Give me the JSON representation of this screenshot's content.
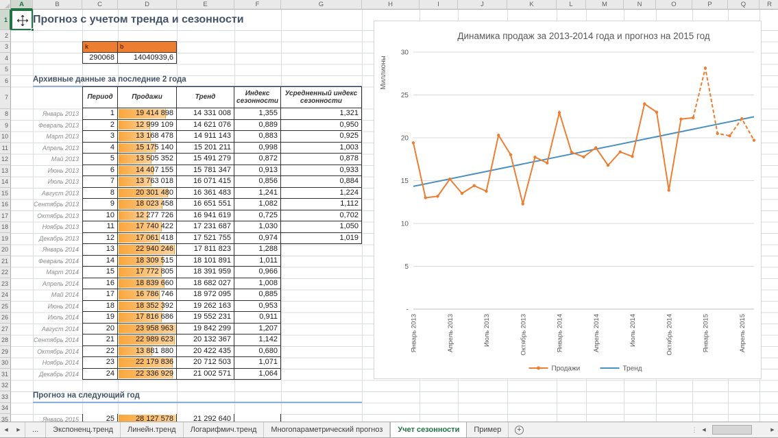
{
  "app": {
    "selected_cell": "A1"
  },
  "colors": {
    "excel_green": "#217346",
    "accent_orange": "#ED7D31",
    "databar_orange": "#F9A63C",
    "trend_blue": "#4A90C2",
    "heading_text": "#44546A",
    "heading_underline": "#8FAADC"
  },
  "grid": {
    "columns": [
      "A",
      "B",
      "C",
      "D",
      "E",
      "F",
      "G",
      "H",
      "I",
      "J",
      "K",
      "L",
      "M",
      "N",
      "O",
      "P",
      "Q",
      "R"
    ],
    "rows": [
      1,
      2,
      3,
      4,
      5,
      6,
      7,
      8,
      9,
      10,
      11,
      12,
      13,
      14,
      15,
      16,
      17,
      18,
      19,
      20,
      21,
      22,
      23,
      24,
      25,
      26,
      27,
      28,
      29,
      30,
      31,
      32,
      33,
      34,
      35
    ]
  },
  "sheet": {
    "title": "Прогноз с учетом тренда и сезонности",
    "kb": {
      "k_label": "k",
      "b_label": "b",
      "k_value": "290068",
      "b_value": "14040939,6"
    },
    "section_archive": "Архивные данные за последние 2 года",
    "section_forecast": "Прогноз на следующий год",
    "table": {
      "headers": [
        "Период",
        "Продажи",
        "Тренд",
        "Индекс сезонности",
        "Усредненный индекс сезонности"
      ],
      "rows": [
        {
          "month": "Январь 2013",
          "period": "1",
          "sales": "19 414 898",
          "trend": "14 331 008",
          "index": "1,355",
          "avg": "1,321"
        },
        {
          "month": "Февраль 2013",
          "period": "2",
          "sales": "12 999 109",
          "trend": "14 621 076",
          "index": "0,889",
          "avg": "0,950"
        },
        {
          "month": "Март 2013",
          "period": "3",
          "sales": "13 168 478",
          "trend": "14 911 143",
          "index": "0,883",
          "avg": "0,925"
        },
        {
          "month": "Апрель 2013",
          "period": "4",
          "sales": "15 175 140",
          "trend": "15 201 211",
          "index": "0,998",
          "avg": "1,003"
        },
        {
          "month": "Май 2013",
          "period": "5",
          "sales": "13 505 352",
          "trend": "15 491 279",
          "index": "0,872",
          "avg": "0,878"
        },
        {
          "month": "Июнь 2013",
          "period": "6",
          "sales": "14 407 155",
          "trend": "15 781 347",
          "index": "0,913",
          "avg": "0,933"
        },
        {
          "month": "Июль 2013",
          "period": "7",
          "sales": "13 763 018",
          "trend": "16 071 415",
          "index": "0,856",
          "avg": "0,884"
        },
        {
          "month": "Август 2013",
          "period": "8",
          "sales": "20 301 480",
          "trend": "16 361 483",
          "index": "1,241",
          "avg": "1,224"
        },
        {
          "month": "Сентябрь 2013",
          "period": "9",
          "sales": "18 023 458",
          "trend": "16 651 551",
          "index": "1,082",
          "avg": "1,112"
        },
        {
          "month": "Октябрь 2013",
          "period": "10",
          "sales": "12 277 726",
          "trend": "16 941 619",
          "index": "0,725",
          "avg": "0,702"
        },
        {
          "month": "Ноябрь 2013",
          "period": "11",
          "sales": "17 740 422",
          "trend": "17 231 687",
          "index": "1,030",
          "avg": "1,050"
        },
        {
          "month": "Декабрь 2013",
          "period": "12",
          "sales": "17 061 418",
          "trend": "17 521 755",
          "index": "0,974",
          "avg": "1,019"
        },
        {
          "month": "Январь 2014",
          "period": "13",
          "sales": "22 940 246",
          "trend": "17 811 823",
          "index": "1,288",
          "avg": ""
        },
        {
          "month": "Февраль 2014",
          "period": "14",
          "sales": "18 309 515",
          "trend": "18 101 891",
          "index": "1,011",
          "avg": ""
        },
        {
          "month": "Март 2014",
          "period": "15",
          "sales": "17 772 805",
          "trend": "18 391 959",
          "index": "0,966",
          "avg": ""
        },
        {
          "month": "Апрель 2014",
          "period": "16",
          "sales": "18 839 660",
          "trend": "18 682 027",
          "index": "1,008",
          "avg": ""
        },
        {
          "month": "Май 2014",
          "period": "17",
          "sales": "16 786 746",
          "trend": "18 972 095",
          "index": "0,885",
          "avg": ""
        },
        {
          "month": "Июнь 2014",
          "period": "18",
          "sales": "18 352 392",
          "trend": "19 262 163",
          "index": "0,953",
          "avg": ""
        },
        {
          "month": "Июль 2014",
          "period": "19",
          "sales": "17 816 686",
          "trend": "19 552 231",
          "index": "0,911",
          "avg": ""
        },
        {
          "month": "Август 2014",
          "period": "20",
          "sales": "23 958 963",
          "trend": "19 842 299",
          "index": "1,207",
          "avg": ""
        },
        {
          "month": "Сентябрь 2014",
          "period": "21",
          "sales": "22 989 623",
          "trend": "20 132 367",
          "index": "1,142",
          "avg": ""
        },
        {
          "month": "Октябрь 2014",
          "period": "22",
          "sales": "13 881 880",
          "trend": "20 422 435",
          "index": "0,680",
          "avg": ""
        },
        {
          "month": "Ноябрь 2014",
          "period": "23",
          "sales": "22 179 836",
          "trend": "20 712 503",
          "index": "1,071",
          "avg": ""
        },
        {
          "month": "Декабрь 2014",
          "period": "24",
          "sales": "22 336 929",
          "trend": "21 002 571",
          "index": "1,064",
          "avg": ""
        }
      ],
      "forecast_row": {
        "month": "Январь 2015",
        "period": "25",
        "sales": "28 127 578",
        "trend": "21 292 640",
        "index": "",
        "avg": ""
      }
    }
  },
  "chart_data": {
    "type": "line",
    "title": "Динамика продаж за 2013-2014 года и прогноз на 2015 год",
    "y_axis_label": "Миллионы",
    "ylim": [
      0,
      30
    ],
    "y_tick_values": [
      30,
      25,
      20,
      15,
      10,
      5,
      0
    ],
    "y_tick_labels": [
      "30",
      "25",
      "20",
      "15",
      "10",
      "5",
      "-"
    ],
    "x_range": [
      1,
      29
    ],
    "x_tick_periods": [
      1,
      4,
      7,
      10,
      13,
      16,
      19,
      22,
      25,
      28
    ],
    "x_tick_labels": [
      "Январь 2013",
      "Апрель 2013",
      "Июль 2013",
      "Октябрь 2013",
      "Январь 2014",
      "Апрель 2014",
      "Июль 2014",
      "Октябрь 2014",
      "Январь 2015",
      "Апрель 2015"
    ],
    "grid": true,
    "legend_position": "bottom",
    "legend": [
      "Продажи",
      "Тренд"
    ],
    "series": [
      {
        "name": "Продажи",
        "color": "#ED7D31",
        "style": "solid-then-dashed",
        "actual_millions": [
          19.41,
          13.0,
          13.17,
          15.18,
          13.51,
          14.41,
          13.76,
          20.3,
          18.02,
          12.28,
          17.74,
          17.06,
          22.94,
          18.31,
          17.77,
          18.84,
          16.79,
          18.35,
          17.82,
          23.96,
          22.99,
          13.88,
          22.18,
          22.34
        ],
        "forecast_millions": [
          28.13,
          20.5,
          20.23,
          22.23,
          19.71
        ]
      },
      {
        "name": "Тренд",
        "color": "#4A90C2",
        "style": "solid",
        "line": [
          [
            1,
            14.33
          ],
          [
            29,
            22.45
          ]
        ]
      }
    ]
  },
  "tabs": {
    "overflow_label": "...",
    "items": [
      {
        "label": "Экспоненц.тренд",
        "active": false
      },
      {
        "label": "Линейн.тренд",
        "active": false
      },
      {
        "label": "Логарифмич.тренд",
        "active": false
      },
      {
        "label": "Многопараметрический прогноз",
        "active": false
      },
      {
        "label": "Учет сезонности",
        "active": true
      },
      {
        "label": "Пример",
        "active": false
      }
    ]
  }
}
